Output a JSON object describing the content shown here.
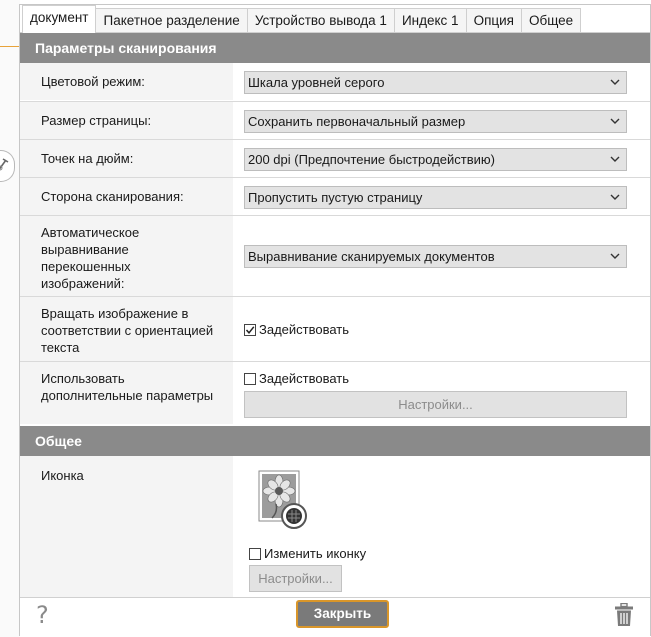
{
  "tabs": [
    {
      "label": "документ",
      "active": true
    },
    {
      "label": "Пакетное разделение",
      "active": false
    },
    {
      "label": "Устройство вывода 1",
      "active": false
    },
    {
      "label": "Индекс 1",
      "active": false
    },
    {
      "label": "Опция",
      "active": false
    },
    {
      "label": "Общее",
      "active": false
    }
  ],
  "scan_section": {
    "title": "Параметры сканирования",
    "color_mode": {
      "label": "Цветовой режим:",
      "value": "Шкала уровней серого"
    },
    "page_size": {
      "label": "Размер страницы:",
      "value": "Сохранить первоначальный размер"
    },
    "dpi": {
      "label": "Точек на дюйм:",
      "value": "200 dpi (Предпочтение быстродействию)"
    },
    "scan_side": {
      "label": "Сторона сканирования:",
      "value": "Пропустить пустую страницу"
    },
    "deskew": {
      "label": "Автоматическое выравнивание перекошенных изображений:",
      "value": "Выравнивание сканируемых документов"
    },
    "rotate": {
      "label": "Вращать изображение в соответствии с ориентацией текста",
      "checkbox_label": "Задействовать",
      "checked": true
    },
    "advanced": {
      "label": "Использовать дополнительные параметры",
      "checkbox_label": "Задействовать",
      "checked": false,
      "button_label": "Настройки..."
    }
  },
  "general_section": {
    "title": "Общее",
    "icon": {
      "label": "Иконка",
      "image": "flower-document-icon",
      "checkbox_label": "Изменить иконку",
      "checked": false,
      "button_label": "Настройки..."
    }
  },
  "footer": {
    "help_label": "?",
    "close_label": "Закрыть",
    "trash_icon": "trash-icon"
  },
  "colors": {
    "section_header": "#8a8a8a",
    "label_bg": "#f4f4f4",
    "select_bg": "#e3e3e3",
    "close_button_bg": "#7a7a7a",
    "close_button_border": "#d9962a"
  }
}
